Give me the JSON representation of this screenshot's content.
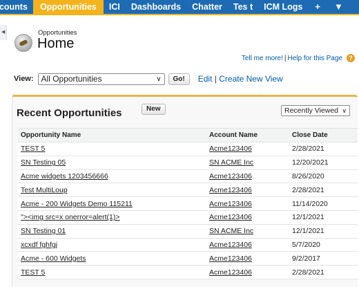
{
  "tabs": [
    {
      "label": "ccounts",
      "active": false
    },
    {
      "label": "Opportunities",
      "active": true
    },
    {
      "label": "ICI",
      "active": false
    },
    {
      "label": "Dashboards",
      "active": false
    },
    {
      "label": "Chatter",
      "active": false
    },
    {
      "label": "Tes t",
      "active": false
    },
    {
      "label": "ICM Logs",
      "active": false
    },
    {
      "label": "+",
      "active": false
    },
    {
      "label": "▼",
      "active": false
    }
  ],
  "colors": {
    "tabbar": "#1e6bb4",
    "active_tab": "#f3b31c",
    "link": "#015ba7"
  },
  "header": {
    "subtitle": "Opportunities",
    "title": "Home"
  },
  "help": {
    "tell_me": "Tell me more!",
    "separator": "|",
    "help_page": "Help for this Page",
    "icon": "?"
  },
  "view": {
    "label": "View:",
    "selected": "All Opportunities",
    "go_label": "Go!",
    "edit_label": "Edit",
    "separator": "|",
    "create_label": "Create New View"
  },
  "recent": {
    "title": "Recent Opportunities",
    "new_label": "New",
    "sort_selected": "Recently Viewed",
    "columns": [
      "Opportunity Name",
      "Account Name",
      "Close Date"
    ],
    "rows": [
      [
        "TEST 5",
        "Acme123406",
        "2/28/2021"
      ],
      [
        "SN Testing 05",
        "SN ACME Inc",
        "12/20/2021"
      ],
      [
        "Acme widgets 1203456666",
        "Acme123406",
        "8/26/2020"
      ],
      [
        "Test MultiLoup",
        "Acme123406",
        "2/28/2021"
      ],
      [
        "Acme - 200 Widgets Demo 115211",
        "Acme123406",
        "11/14/2020"
      ],
      [
        "\"><img src=x onerror=alert(1)>",
        "Acme123406",
        "12/1/2021"
      ],
      [
        "SN Testing 01",
        "SN ACME Inc",
        "12/1/2021"
      ],
      [
        "xcxdf fghfgj",
        "Acme123406",
        "5/7/2020"
      ],
      [
        "Acme - 600 Widgets",
        "Acme123406",
        "9/2/2017"
      ],
      [
        "TEST 5",
        "Acme123406",
        "2/28/2021"
      ]
    ]
  }
}
